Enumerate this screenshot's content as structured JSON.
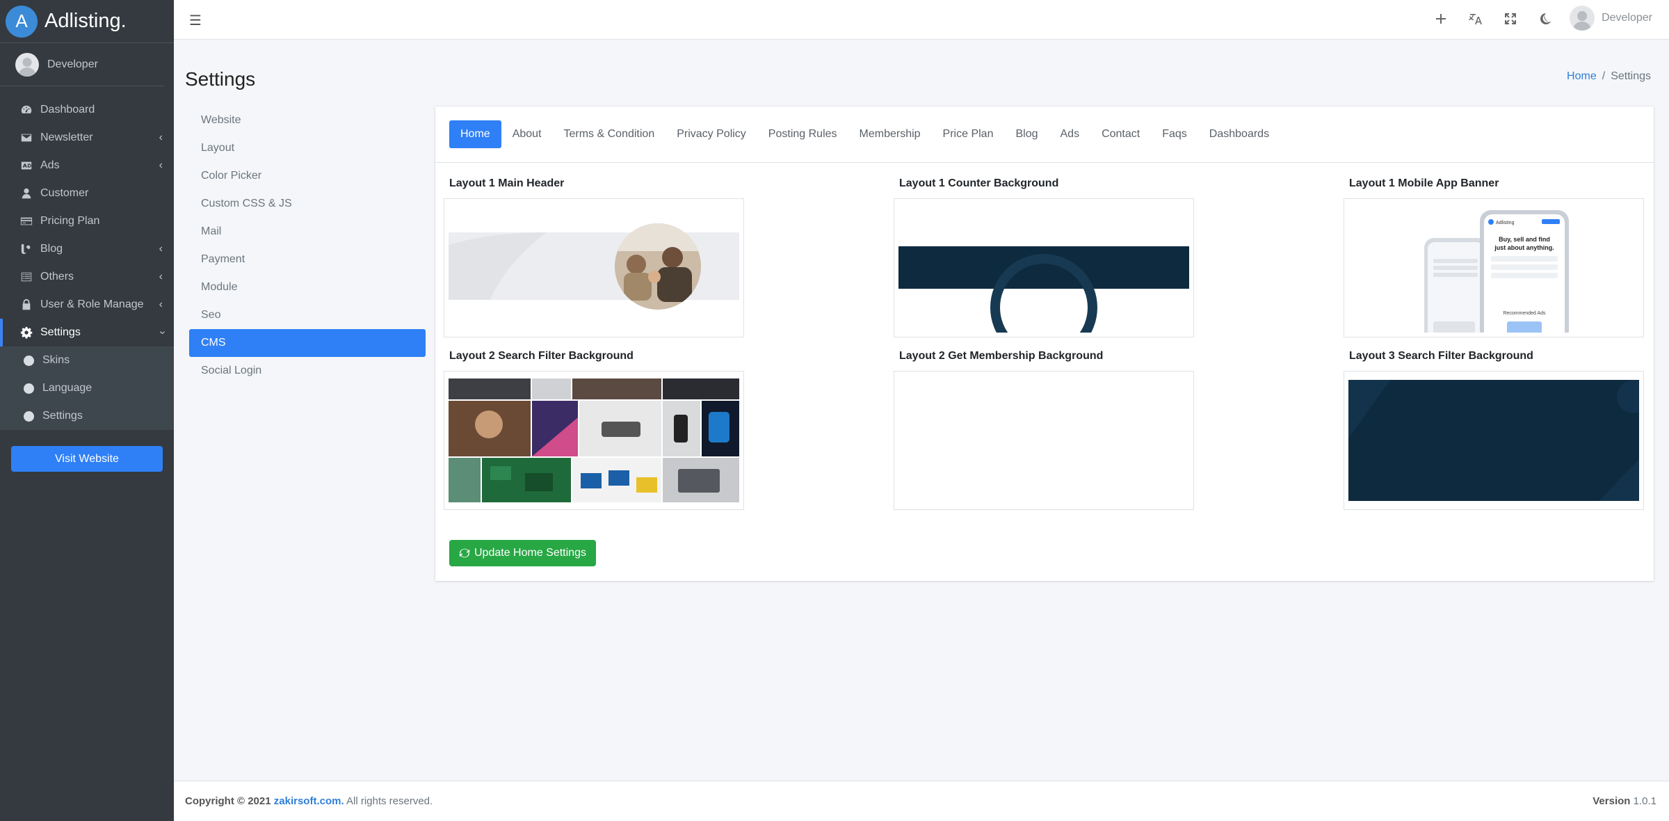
{
  "brand": {
    "logo_letter": "A",
    "name": "Adlisting."
  },
  "sidebar": {
    "user_name": "Developer",
    "items": [
      {
        "label": "Dashboard",
        "icon": "tachometer-icon",
        "has_children": false
      },
      {
        "label": "Newsletter",
        "icon": "envelope-icon",
        "has_children": true
      },
      {
        "label": "Ads",
        "icon": "ad-icon",
        "has_children": true
      },
      {
        "label": "Customer",
        "icon": "user-icon",
        "has_children": false
      },
      {
        "label": "Pricing Plan",
        "icon": "credit-card-icon",
        "has_children": false
      },
      {
        "label": "Blog",
        "icon": "blog-icon",
        "has_children": true
      },
      {
        "label": "Others",
        "icon": "list-icon",
        "has_children": true
      },
      {
        "label": "User & Role Manage",
        "icon": "lock-icon",
        "has_children": true
      },
      {
        "label": "Settings",
        "icon": "gear-icon",
        "has_children": true,
        "expanded": true
      }
    ],
    "settings_children": [
      "Skins",
      "Language",
      "Settings"
    ],
    "visit_website": "Visit Website"
  },
  "topbar": {
    "user_name": "Developer"
  },
  "page": {
    "title": "Settings",
    "breadcrumb": {
      "home": "Home",
      "separator": "/",
      "current": "Settings"
    }
  },
  "settings_menu": [
    "Website",
    "Layout",
    "Color Picker",
    "Custom CSS & JS",
    "Mail",
    "Payment",
    "Module",
    "Seo",
    "CMS",
    "Social Login"
  ],
  "settings_menu_active": "CMS",
  "tabs": [
    "Home",
    "About",
    "Terms & Condition",
    "Privacy Policy",
    "Posting Rules",
    "Membership",
    "Price Plan",
    "Blog",
    "Ads",
    "Contact",
    "Faqs",
    "Dashboards"
  ],
  "tabs_active": "Home",
  "images": {
    "l1_main_header": "Layout 1 Main Header",
    "l1_counter_bg": "Layout 1 Counter Background",
    "l1_mobile_banner": "Layout 1 Mobile App Banner",
    "l2_search_bg": "Layout 2 Search Filter Background",
    "l2_membership_bg": "Layout 2 Get Membership Background",
    "l3_search_bg": "Layout 3 Search Filter Background"
  },
  "mobile_banner_text": {
    "headline": "Buy, sell and find just about anything.",
    "section": "Recommended Ads",
    "app": "Adlisting"
  },
  "update_button": "Update Home Settings",
  "footer": {
    "copyright": "Copyright © 2021",
    "site": "zakirsoft.com.",
    "rights": "All rights reserved.",
    "version_label": "Version",
    "version": "1.0.1"
  },
  "colors": {
    "primary": "#2f80f6",
    "sidebar_bg": "#343a40",
    "success": "#28a745",
    "dark_navy": "#0e2a3f"
  }
}
